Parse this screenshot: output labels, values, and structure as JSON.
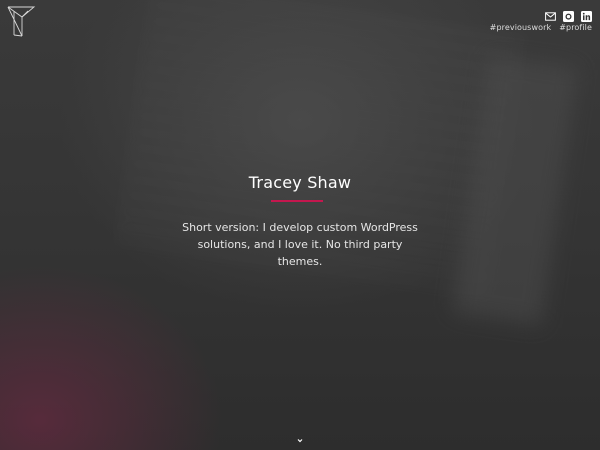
{
  "hero": {
    "name": "Tracey Shaw",
    "tagline": "Short version: I develop custom WordPress solutions, and I love it. No third party themes."
  },
  "header": {
    "logo_icon": "triangle-t-logo-icon",
    "social_icons": [
      "mail-icon",
      "github-icon",
      "linkedin-icon"
    ],
    "hashtags": [
      "#previouswork",
      "#profile"
    ]
  },
  "colors": {
    "accent": "#c4174e",
    "text": "#ffffff",
    "background": "#333333"
  },
  "scroll_icon": "chevron-down-icon"
}
